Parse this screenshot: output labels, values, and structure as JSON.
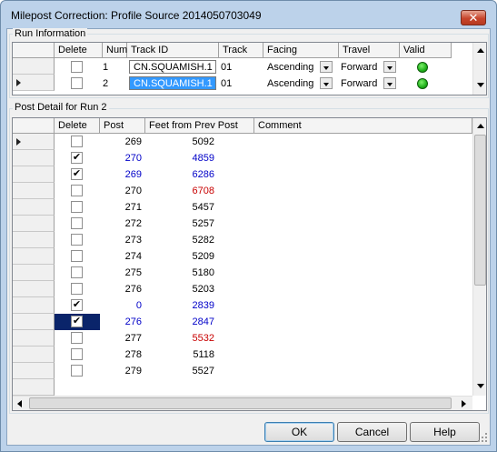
{
  "window": {
    "title": "Milepost Correction: Profile Source 2014050703049",
    "close_glyph": "✕"
  },
  "run_info": {
    "group_label": "Run Information",
    "headers": [
      "Delete",
      "Num",
      "Track ID",
      "Track",
      "Facing",
      "Travel",
      "Valid"
    ],
    "rows": [
      {
        "delete": false,
        "num": "1",
        "track_id": "CN.SQUAMISH.1",
        "track": "01",
        "facing": "Ascending",
        "travel": "Forward",
        "valid": true,
        "current": false,
        "selected": false
      },
      {
        "delete": false,
        "num": "2",
        "track_id": "CN.SQUAMISH.1",
        "track": "01",
        "facing": "Ascending",
        "travel": "Forward",
        "valid": true,
        "current": true,
        "selected": true
      }
    ]
  },
  "post_detail": {
    "group_label": "Post Detail for Run 2",
    "headers": [
      "Delete",
      "Post",
      "Feet from Prev Post",
      "Comment"
    ],
    "rows": [
      {
        "delete": false,
        "post": "269",
        "feet": "5092",
        "comment": "",
        "post_color": "black",
        "feet_color": "black",
        "current": true
      },
      {
        "delete": true,
        "post": "270",
        "feet": "4859",
        "comment": "",
        "post_color": "blue",
        "feet_color": "blue"
      },
      {
        "delete": true,
        "post": "269",
        "feet": "6286",
        "comment": "",
        "post_color": "blue",
        "feet_color": "blue"
      },
      {
        "delete": false,
        "post": "270",
        "feet": "6708",
        "comment": "",
        "post_color": "black",
        "feet_color": "red"
      },
      {
        "delete": false,
        "post": "271",
        "feet": "5457",
        "comment": "",
        "post_color": "black",
        "feet_color": "black"
      },
      {
        "delete": false,
        "post": "272",
        "feet": "5257",
        "comment": "",
        "post_color": "black",
        "feet_color": "black"
      },
      {
        "delete": false,
        "post": "273",
        "feet": "5282",
        "comment": "",
        "post_color": "black",
        "feet_color": "black"
      },
      {
        "delete": false,
        "post": "274",
        "feet": "5209",
        "comment": "",
        "post_color": "black",
        "feet_color": "black"
      },
      {
        "delete": false,
        "post": "275",
        "feet": "5180",
        "comment": "",
        "post_color": "black",
        "feet_color": "black"
      },
      {
        "delete": false,
        "post": "276",
        "feet": "5203",
        "comment": "",
        "post_color": "black",
        "feet_color": "black"
      },
      {
        "delete": true,
        "post": "0",
        "feet": "2839",
        "comment": "",
        "post_color": "blue",
        "feet_color": "blue"
      },
      {
        "delete": true,
        "post": "276",
        "feet": "2847",
        "comment": "",
        "post_color": "blue",
        "feet_color": "blue",
        "selected": true
      },
      {
        "delete": false,
        "post": "277",
        "feet": "5532",
        "comment": "",
        "post_color": "black",
        "feet_color": "red"
      },
      {
        "delete": false,
        "post": "278",
        "feet": "5118",
        "comment": "",
        "post_color": "black",
        "feet_color": "black"
      },
      {
        "delete": false,
        "post": "279",
        "feet": "5527",
        "comment": "",
        "post_color": "black",
        "feet_color": "black"
      }
    ]
  },
  "buttons": {
    "ok": "OK",
    "cancel": "Cancel",
    "help": "Help"
  },
  "colors": {
    "link_blue": "#0000c8",
    "error_red": "#c80000",
    "selection": "#3399ff",
    "valid_green": "#1fb01a"
  }
}
